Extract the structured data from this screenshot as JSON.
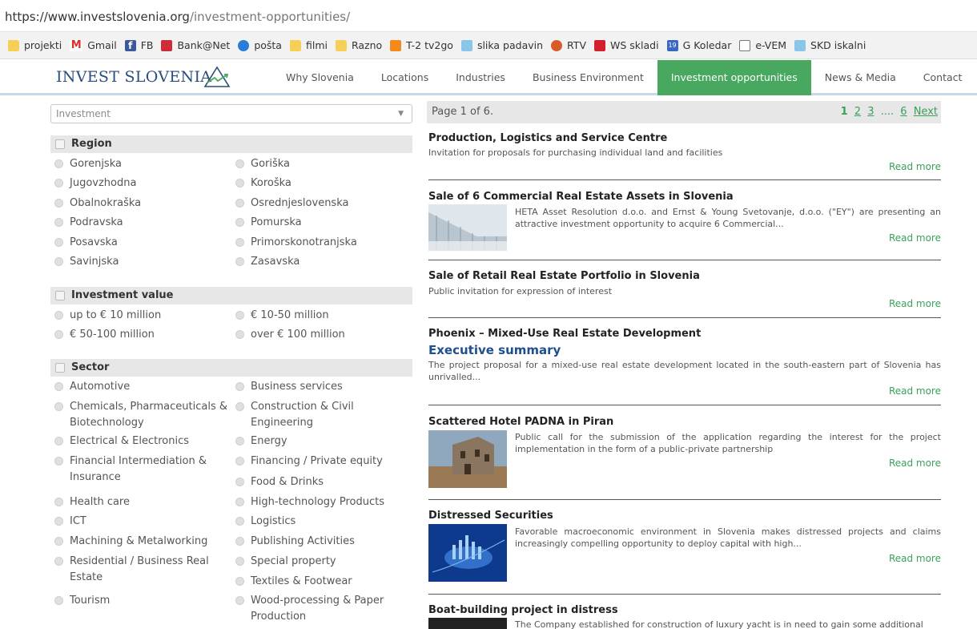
{
  "browser": {
    "url_host": "https://www.investslovenia.org",
    "url_path": "/investment-opportunities/",
    "bookmarks": [
      {
        "icon": "folder-icon",
        "label": "projekti"
      },
      {
        "icon": "gmail-icon",
        "label": "Gmail"
      },
      {
        "icon": "facebook-icon",
        "label": "FB"
      },
      {
        "icon": "bank-icon",
        "label": "Bank@Net"
      },
      {
        "icon": "mail-icon",
        "label": "pošta"
      },
      {
        "icon": "folder-icon",
        "label": "filmi"
      },
      {
        "icon": "folder-icon",
        "label": "Razno"
      },
      {
        "icon": "tv-icon",
        "label": "T-2 tv2go"
      },
      {
        "icon": "weather-icon",
        "label": "slika padavin"
      },
      {
        "icon": "rtv-icon",
        "label": "RTV"
      },
      {
        "icon": "ws-icon",
        "label": "WS skladi"
      },
      {
        "icon": "calendar-icon",
        "label": "G Koledar"
      },
      {
        "icon": "document-icon",
        "label": "e-VEM"
      },
      {
        "icon": "weather-icon",
        "label": "SKD iskalni"
      }
    ]
  },
  "site": {
    "logo": "INVEST SLOVENIA",
    "nav": [
      "Why Slovenia",
      "Locations",
      "Industries",
      "Business Environment",
      "Investment opportunities",
      "News & Media",
      "Contact"
    ],
    "nav_active": "Investment opportunities"
  },
  "filters": {
    "select_value": "Investment",
    "region": {
      "title": "Region",
      "col1": [
        "Gorenjska",
        "Jugovzhodna",
        "Obalnokraška",
        "Podravska",
        "Posavska",
        "Savinjska"
      ],
      "col2": [
        "Goriška",
        "Koroška",
        "Osrednjeslovenska",
        "Pomurska",
        "Primorskonotranjska",
        "Zasavska"
      ]
    },
    "value": {
      "title": "Investment value",
      "col1": [
        "up to € 10 million",
        "€ 50-100 million"
      ],
      "col2": [
        "€ 10-50 million",
        "over € 100 million"
      ]
    },
    "sector": {
      "title": "Sector",
      "col1": [
        "Automotive",
        "Chemicals, Pharmaceuticals &\nBiotechnology",
        "Electrical & Electronics",
        "Financial Intermediation &\nInsurance",
        "Health care",
        "ICT",
        "Machining & Metalworking",
        "Residential / Business Real\nEstate",
        "Tourism"
      ],
      "col2": [
        "Business services",
        "Construction & Civil\nEngineering",
        "Energy",
        "Financing / Private equity",
        "Food & Drinks",
        "High-technology Products",
        "Logistics",
        "Publishing Activities",
        "Special property",
        "Textiles & Footwear",
        "Wood-processing & Paper\nProduction"
      ]
    }
  },
  "list": {
    "pager_label": "Page 1 of 6.",
    "pages": [
      "1",
      "2",
      "3",
      "....",
      "6",
      "Next"
    ],
    "read_more": "Read more",
    "items": [
      {
        "title": "Production, Logistics and Service Centre",
        "desc": "Invitation for proposals for purchasing individual land and facilities"
      },
      {
        "title": "Sale of 6 Commercial Real Estate Assets in Slovenia",
        "desc": "HETA Asset Resolution d.o.o. and Ernst & Young Svetovanje, d.o.o. (\"EY\") are presenting an attractive investment opportunity to acquire 6 Commercial..."
      },
      {
        "title": "Sale of Retail Real Estate Portfolio in Slovenia",
        "desc": "Public invitation for expression of interest"
      },
      {
        "title": "Phoenix – Mixed-Use Real Estate Development",
        "subtitle": "Executive summary",
        "desc": "The project proposal for a mixed-use real estate development located in the south-eastern part of Slovenia  has unrivalled..."
      },
      {
        "title": "Scattered Hotel PADNA in Piran",
        "desc": "Public call for the submission of the application regarding the interest for the project implementation in the form of a public-private partnership"
      },
      {
        "title": "Distressed Securities",
        "desc": "Favorable macroeconomic environment in Slovenia makes distressed projects and claims increasingly compelling opportunity to deploy capital with high..."
      },
      {
        "title": "Boat-building project in distress",
        "desc": "The Company established for construction of luxury yacht is in need to gain some additional"
      }
    ]
  }
}
